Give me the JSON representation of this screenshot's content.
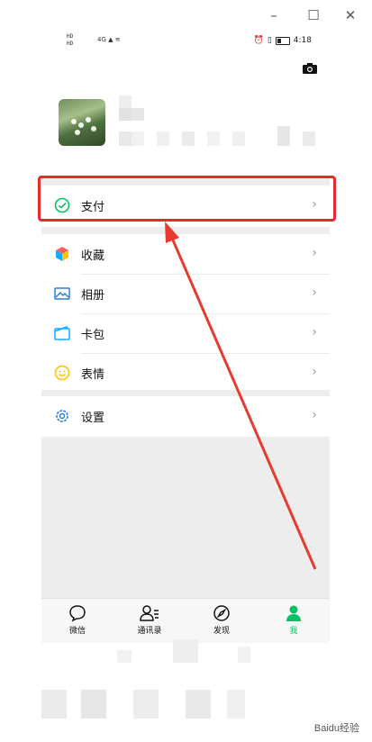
{
  "status_bar": {
    "left_indicators": [
      "HD",
      "HD"
    ],
    "network": "4G",
    "time": "4:18"
  },
  "menu": {
    "pay": {
      "label": "支付",
      "icon": "wechat-pay-icon"
    },
    "favorites": {
      "label": "收藏",
      "icon": "favorites-cube-icon"
    },
    "album": {
      "label": "相册",
      "icon": "photo-album-icon"
    },
    "cards": {
      "label": "卡包",
      "icon": "card-wallet-icon"
    },
    "stickers": {
      "label": "表情",
      "icon": "smiley-icon"
    },
    "settings": {
      "label": "设置",
      "icon": "gear-icon"
    }
  },
  "tabs": [
    {
      "label": "微信",
      "icon": "chat-bubble-icon",
      "active": false
    },
    {
      "label": "通讯录",
      "icon": "contacts-icon",
      "active": false
    },
    {
      "label": "发现",
      "icon": "compass-icon",
      "active": false
    },
    {
      "label": "我",
      "icon": "person-icon",
      "active": true
    }
  ],
  "watermark": "Baidu经验",
  "colors": {
    "accent": "#07c160",
    "highlight": "#e02e2e",
    "background": "#ededed"
  }
}
